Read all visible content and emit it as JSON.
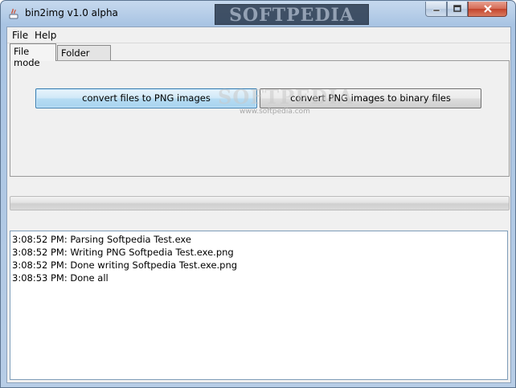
{
  "window": {
    "title": "bin2img v1.0 alpha",
    "watermark": "SOFTPEDIA"
  },
  "menubar": {
    "items": [
      {
        "label": "File"
      },
      {
        "label": "Help"
      }
    ]
  },
  "tabs": [
    {
      "label": "File mode",
      "selected": true
    },
    {
      "label": "Folder mode",
      "selected": false
    }
  ],
  "buttons": {
    "to_png": "convert files to PNG images",
    "to_binary": "convert PNG images to binary files"
  },
  "watermark_small": "www.softpedia.com",
  "watermark_big": "SOFTPEDIA",
  "progress": {
    "value": 0
  },
  "log": [
    "3:08:52 PM: Parsing Softpedia Test.exe",
    "3:08:52 PM: Writing PNG Softpedia Test.exe.png",
    "3:08:52 PM: Done writing Softpedia Test.exe.png",
    "3:08:53 PM: Done all"
  ],
  "colors": {
    "accent_button": "#b6dcf3",
    "close_button": "#c3442c"
  }
}
